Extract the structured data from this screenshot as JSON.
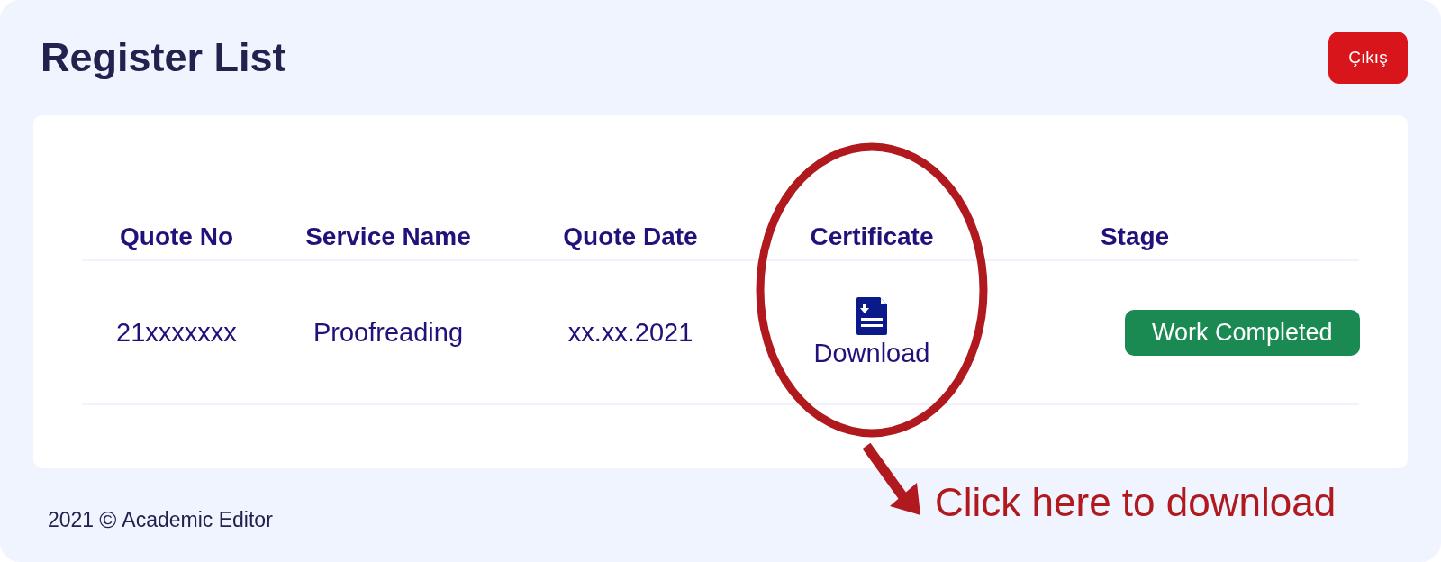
{
  "page": {
    "title": "Register List",
    "logout_button": "Çıkış"
  },
  "table": {
    "columns": [
      "Quote No",
      "Service Name",
      "Quote Date",
      "Certificate",
      "Stage"
    ],
    "rows": [
      {
        "quote_no": "21xxxxxxx",
        "service_name": "Proofreading",
        "quote_date": "xx.xx.2021",
        "certificate": "Download",
        "stage": "Work Completed"
      }
    ]
  },
  "footer": {
    "year": "2021",
    "copyright_symbol": "©",
    "company": "Academic Editor"
  },
  "annotation": {
    "callout": "Click here to download"
  }
}
